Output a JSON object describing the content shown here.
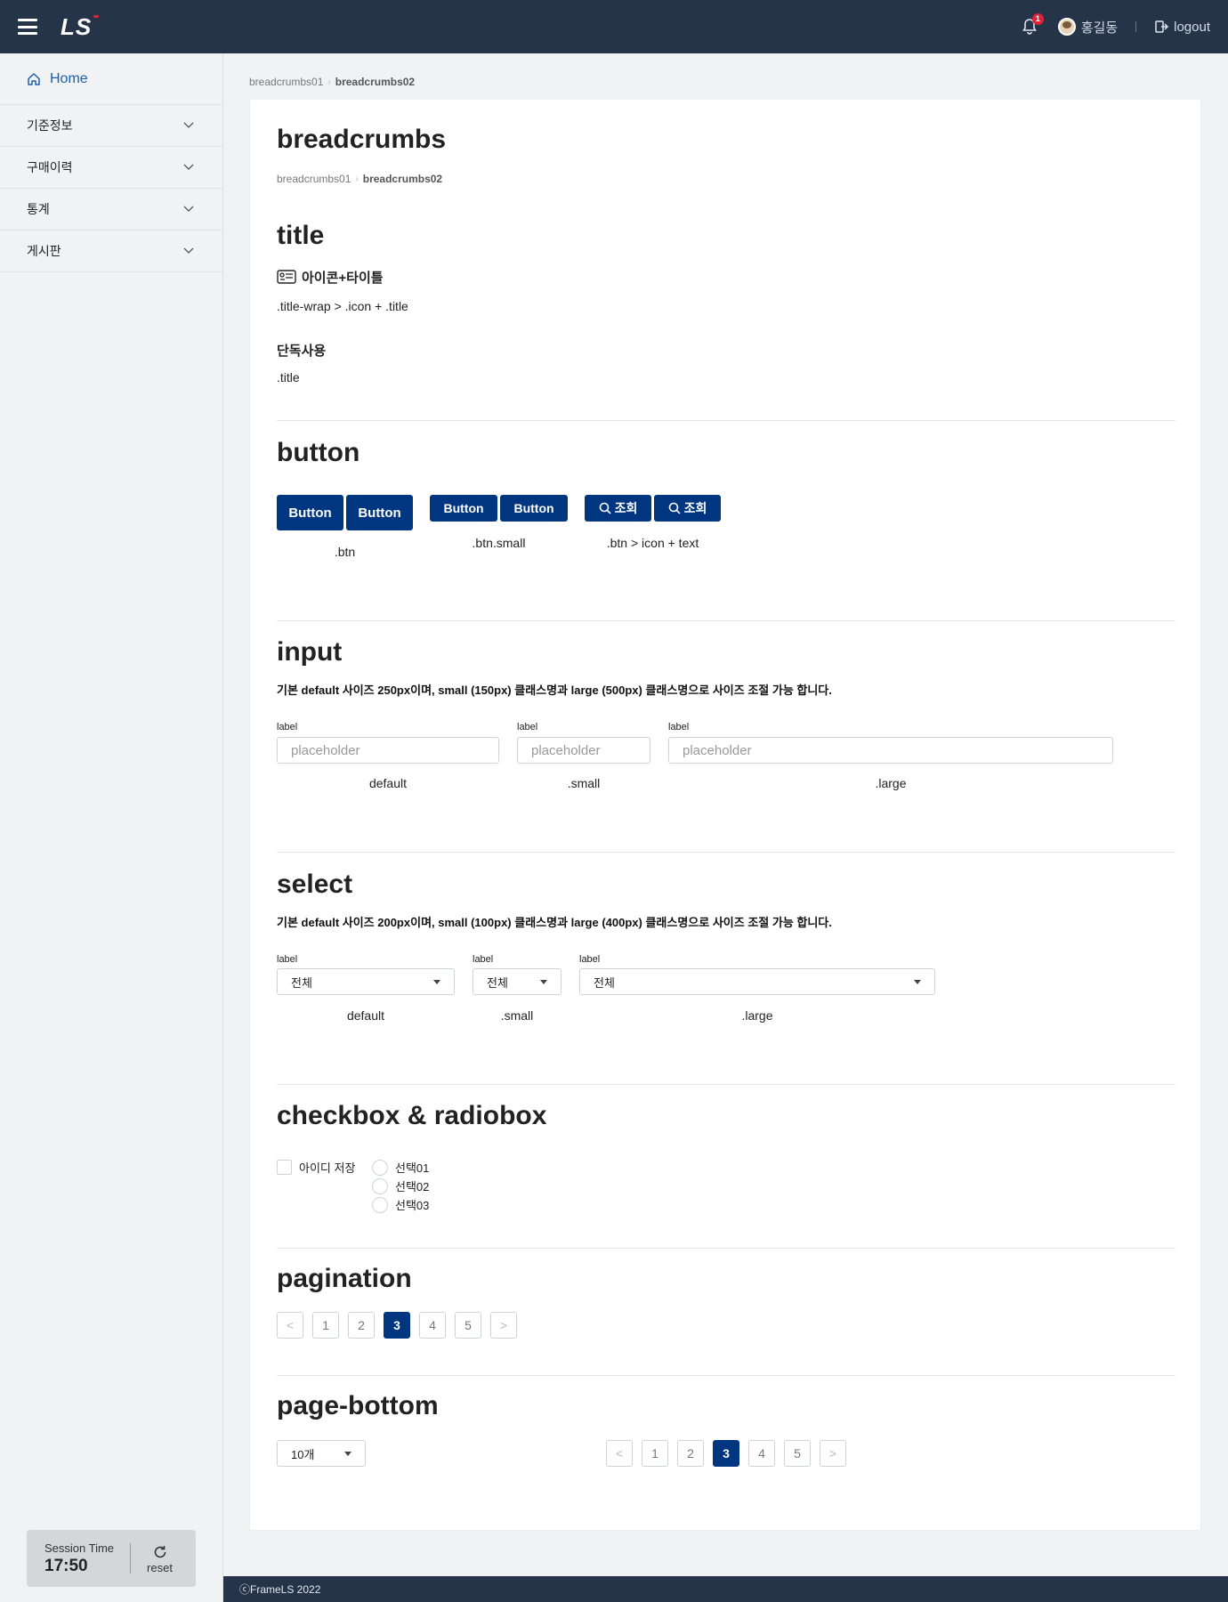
{
  "header": {
    "logo_text": "LS",
    "notification_count": "1",
    "user_name": "홍길동",
    "logout_label": "logout"
  },
  "sidebar": {
    "home_label": "Home",
    "items": [
      {
        "label": "기준정보"
      },
      {
        "label": "구매이력"
      },
      {
        "label": "통계"
      },
      {
        "label": "게시판"
      }
    ],
    "session": {
      "label": "Session Time",
      "time": "17:50",
      "reset_label": "reset"
    }
  },
  "breadcrumbs": {
    "items": [
      "breadcrumbs01",
      "breadcrumbs02"
    ]
  },
  "page": {
    "title": "breadcrumbs",
    "crumbs": [
      "breadcrumbs01",
      "breadcrumbs02"
    ]
  },
  "title_section": {
    "heading": "title",
    "icon_title": "아이콘+타이틀",
    "icon_title_class": ".title-wrap > .icon + .title",
    "solo_title": "단독사용",
    "solo_class": ".title"
  },
  "button_section": {
    "heading": "button",
    "btn_label": "Button",
    "btn_caption": ".btn",
    "small_caption": ".btn.small",
    "icon_btn_label": "조회",
    "icon_caption": ".btn > icon + text"
  },
  "input_section": {
    "heading": "input",
    "description": "기본 default 사이즈 250px이며, small (150px) 클래스명과 large (500px) 클래스명으로 사이즈 조절 가능 합니다.",
    "fields": [
      {
        "label": "label",
        "placeholder": "placeholder",
        "caption": "default"
      },
      {
        "label": "label",
        "placeholder": "placeholder",
        "caption": ".small"
      },
      {
        "label": "label",
        "placeholder": "placeholder",
        "caption": ".large"
      }
    ]
  },
  "select_section": {
    "heading": "select",
    "description": "기본 default 사이즈 200px이며, small (100px) 클래스명과 large (400px) 클래스명으로 사이즈 조절 가능 합니다.",
    "fields": [
      {
        "label": "label",
        "value": "전체",
        "caption": "default"
      },
      {
        "label": "label",
        "value": "전체",
        "caption": ".small"
      },
      {
        "label": "label",
        "value": "전체",
        "caption": ".large"
      }
    ]
  },
  "check_section": {
    "heading": "checkbox & radiobox",
    "checkbox_label": "아이디 저장",
    "radios": [
      "선택01",
      "선택02",
      "선택03"
    ]
  },
  "pagination_section": {
    "heading": "pagination",
    "prev": "<",
    "next": ">",
    "pages": [
      "1",
      "2",
      "3",
      "4",
      "5"
    ],
    "active_page": "3"
  },
  "page_bottom_section": {
    "heading": "page-bottom",
    "page_size": "10개"
  },
  "footer": {
    "copyright": "ⓒFrameLS 2022"
  },
  "colors": {
    "primary": "#003680",
    "header_bg": "#253448",
    "home_link": "#1a5fa7",
    "badge": "#e0223b"
  }
}
